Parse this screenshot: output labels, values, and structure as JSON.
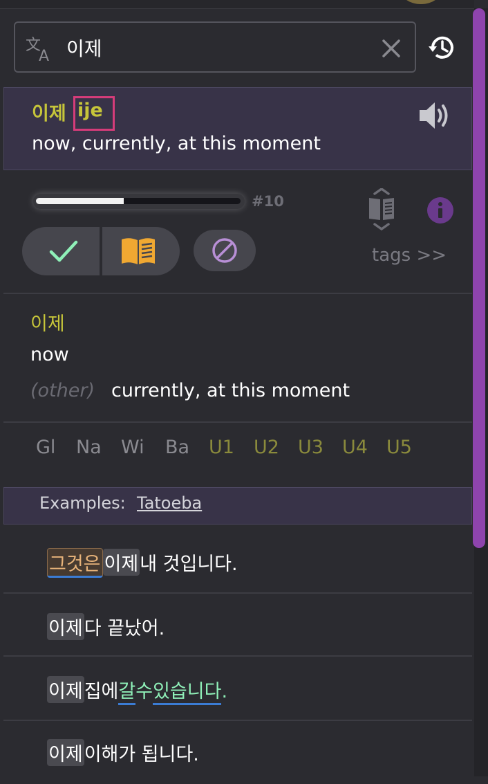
{
  "search": {
    "value": "이제",
    "placeholder": ""
  },
  "entry": {
    "word": "이제",
    "romanization": "ije",
    "definition": "now, currently, at this moment"
  },
  "progress": {
    "fraction": 0.43,
    "rank_label": "#10"
  },
  "tags_link": "tags >>",
  "definition_section": {
    "word": "이제",
    "sense1": "now",
    "other_tag": "(other)",
    "sense2": "currently, at this moment"
  },
  "sources": {
    "items": [
      "Gl",
      "Na",
      "Wi",
      "Ba",
      "U1",
      "U2",
      "U3",
      "U4",
      "U5"
    ],
    "active_color": "#8a8a3c",
    "inactive_color": "#8a8a90"
  },
  "examples": {
    "label": "Examples:",
    "source": "Tatoeba",
    "sentences": [
      {
        "parts": [
          "그것은",
          " ",
          "이제",
          " 내 것입니다."
        ]
      },
      {
        "parts": [
          "이제",
          " 다 끝났어."
        ]
      },
      {
        "parts": [
          "이제",
          " 집에 ",
          "갈",
          " ",
          "수",
          " ",
          "있습니다",
          "."
        ]
      },
      {
        "parts": [
          "이제",
          " 이해가 됩니다."
        ]
      }
    ]
  },
  "colors": {
    "accent_yellow": "#c6c53a",
    "check_green": "#8ff0b8",
    "book_orange": "#f0a832",
    "ban_purple": "#b88fd6",
    "scroll_purple": "#8e44ad",
    "highlight_pink": "#d63c7a"
  },
  "icons": [
    "translate-icon",
    "clear-icon",
    "history-icon",
    "speaker-icon",
    "book-toggle-icon",
    "info-icon",
    "check-icon",
    "book-icon",
    "ban-icon"
  ]
}
